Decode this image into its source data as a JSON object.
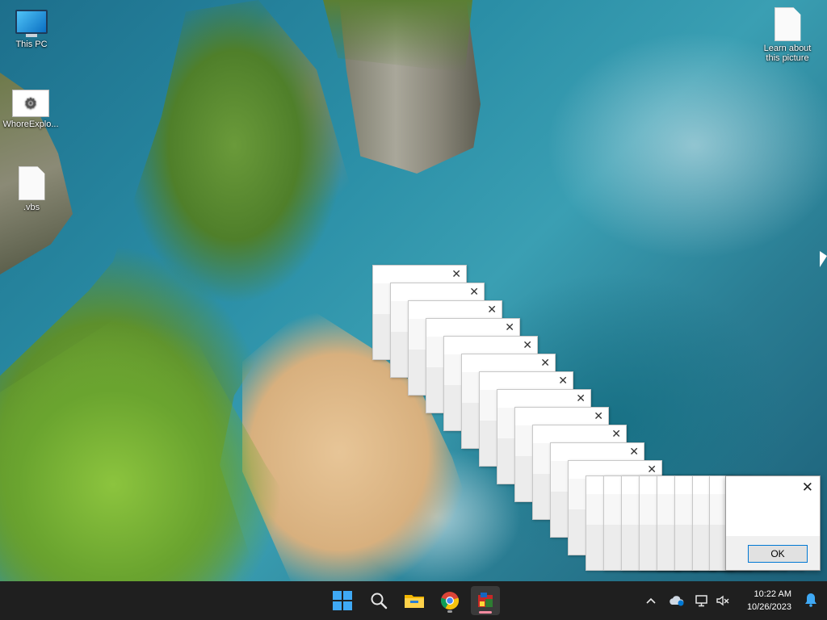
{
  "desktop_icons": [
    {
      "label": "This PC",
      "icon": "computer-icon"
    },
    {
      "label": "WhoreExplo...",
      "icon": "settings-file-icon"
    },
    {
      "label": ".vbs",
      "icon": "document-icon"
    },
    {
      "label": "Learn about this picture",
      "icon": "document-icon"
    }
  ],
  "dialogs": {
    "close_glyph": "✕",
    "ok_label": "OK",
    "stacked_count": 20
  },
  "taskbar": {
    "apps": [
      {
        "name": "start",
        "icon": "windows-logo-icon"
      },
      {
        "name": "search",
        "icon": "search-icon"
      },
      {
        "name": "file-explorer",
        "icon": "folder-icon"
      },
      {
        "name": "chrome",
        "icon": "chrome-icon"
      },
      {
        "name": "running-app",
        "icon": "app-icon",
        "active": true
      }
    ],
    "tray": {
      "overflow_glyph": "^",
      "cloud_icon": "onedrive-icon",
      "network_icon": "network-icon",
      "volume_icon": "volume-muted-icon"
    },
    "time": "10:22 AM",
    "date": "10/26/2023",
    "notification_icon": "bell-icon"
  },
  "colors": {
    "taskbar_bg": "#1f1f1f",
    "accent": "#0078d4",
    "active_indicator": "#f38ba0"
  }
}
